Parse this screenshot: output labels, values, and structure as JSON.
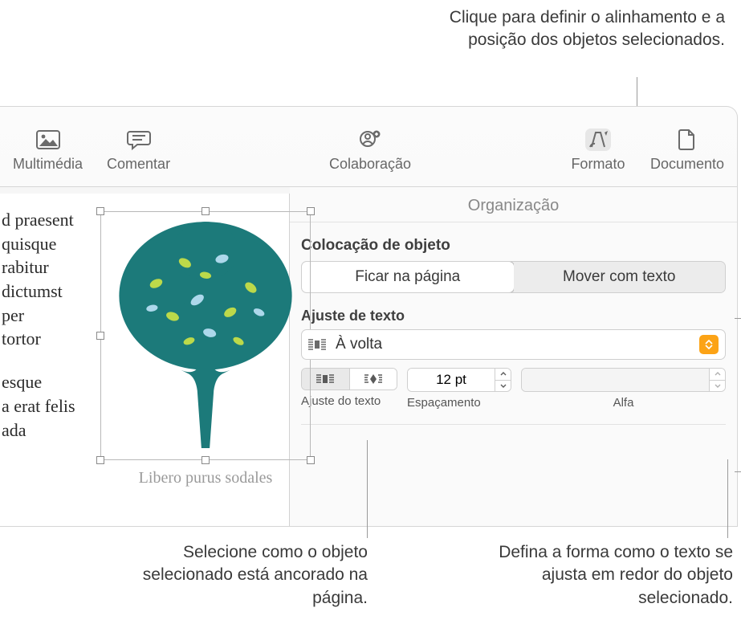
{
  "callouts": {
    "top": "Clique para definir o alinhamento e a posição dos objetos selecionados.",
    "bottom_left": "Selecione como o objeto selecionado está ancorado na página.",
    "bottom_right": "Defina a forma como o texto se ajusta em redor do objeto selecionado."
  },
  "toolbar": {
    "multimedia": "Multimédia",
    "comment": "Comentar",
    "collaboration": "Colaboração",
    "format": "Formato",
    "document": "Documento"
  },
  "canvas": {
    "top_lines": [
      "d praesent",
      "quisque",
      "rabitur",
      "dictumst",
      "per",
      "tortor"
    ],
    "bottom_lines": [
      "esque",
      "a erat felis",
      "ada"
    ],
    "caption": "Libero purus sodales"
  },
  "inspector": {
    "header": "Organização",
    "placement_label": "Colocação de objeto",
    "seg_stay": "Ficar na página",
    "seg_move": "Mover com texto",
    "wrap_label": "Ajuste de texto",
    "wrap_value": "À volta",
    "fit_label": "Ajuste do texto",
    "spacing_label": "Espaçamento",
    "spacing_value": "12 pt",
    "alpha_label": "Alfa",
    "alpha_value": ""
  }
}
